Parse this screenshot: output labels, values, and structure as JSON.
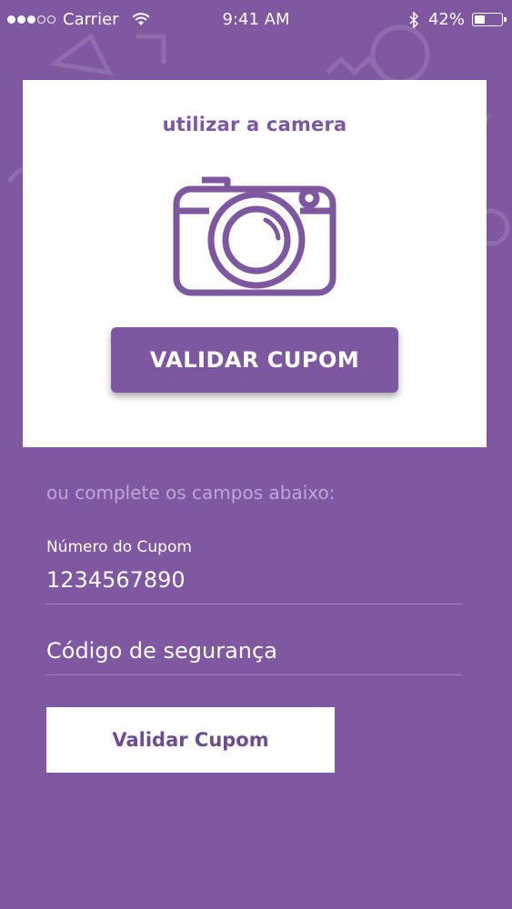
{
  "status_bar": {
    "carrier": "Carrier",
    "time": "9:41 AM",
    "battery": "42%",
    "battery_level": 0.42
  },
  "camera_card": {
    "title": "utilizar a camera",
    "icon": "camera-icon",
    "button_label": "VALIDAR CUPOM"
  },
  "form": {
    "alt_text": "ou complete os campos abaixo:",
    "coupon_label": "Número do Cupom",
    "coupon_value": "1234567890",
    "security_placeholder": "Código de segurança",
    "submit_label": "Validar Cupom"
  },
  "colors": {
    "background": "#7f58a1",
    "accent": "#7d57a0",
    "card": "#ffffff"
  }
}
